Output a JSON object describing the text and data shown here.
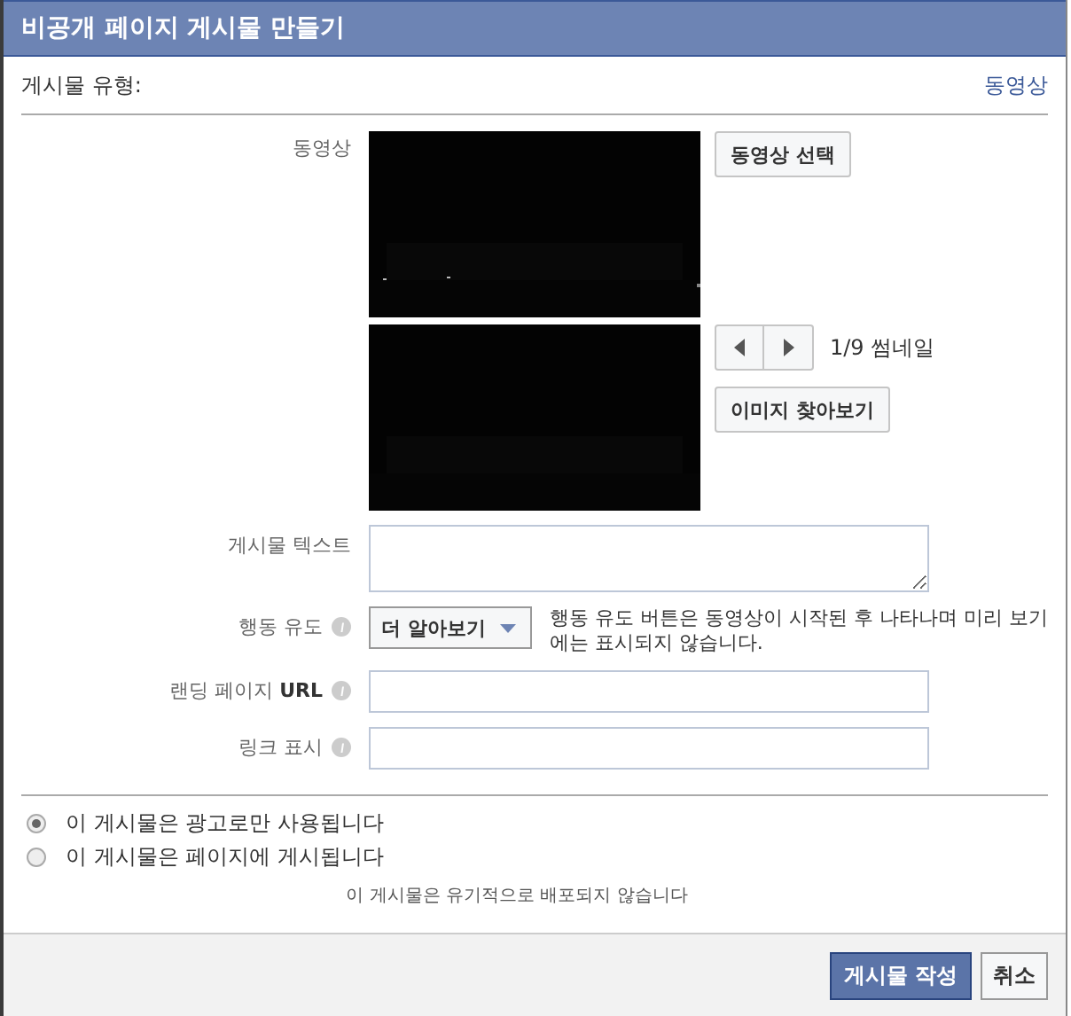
{
  "window": {
    "title": "비공개 페이지 게시물 만들기"
  },
  "post_type": {
    "label": "게시물 유형:",
    "value": "동영상"
  },
  "video": {
    "label": "동영상",
    "select_button": "동영상 선택"
  },
  "thumbnail": {
    "counter": "1/9 썸네일",
    "browse_button": "이미지 찾아보기"
  },
  "fields": [
    {
      "kind": "textarea",
      "label": "게시물 텍스트",
      "info": false
    },
    {
      "kind": "dropdown",
      "label": "행동 유도",
      "info": true,
      "value": "더 알아보기",
      "note": "행동 유도 버튼은 동영상이 시작된 후 나타나며 미리 보기에는 표시되지 않습니다."
    },
    {
      "kind": "input",
      "label": "랜딩 페이지 **URL**",
      "info": true
    },
    {
      "kind": "input",
      "label": "링크 표시",
      "info": true
    }
  ],
  "options": [
    {
      "label": "이 게시물은 광고로만 사용됩니다",
      "selected": true
    },
    {
      "label": "이 게시물은 페이지에 게시됩니다",
      "selected": false
    }
  ],
  "distribution_note": "이 게시물은 유기적으로 배포되지 않습니다",
  "buttons": [
    {
      "label": "게시물 작성",
      "kind": "primary"
    },
    {
      "label": "취소",
      "kind": "secondary"
    }
  ]
}
